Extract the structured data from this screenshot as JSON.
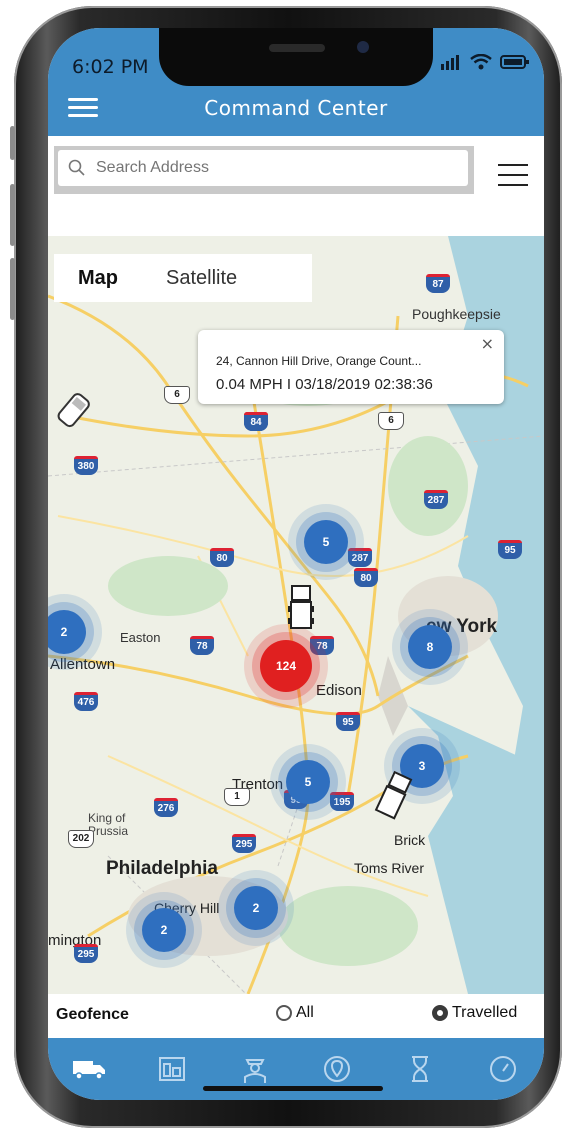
{
  "status_bar": {
    "time": "6:02 PM"
  },
  "header": {
    "title": "Command Center"
  },
  "search": {
    "placeholder": "Search Address"
  },
  "map": {
    "tabs": [
      "Map",
      "Satellite"
    ],
    "active_tab": "Map",
    "popup": {
      "address": "24, Cannon Hill Drive, Orange Count...",
      "info": "0.04 MPH  I  03/18/2019 02:38:36",
      "close": "×"
    },
    "places": [
      "Poughkeepsie",
      "Easton",
      "Allentown",
      "Edison",
      "Trenton",
      "King of Prussia",
      "Philadelphia",
      "Cherry Hill",
      "Brick",
      "Toms River",
      "ew York",
      "mington"
    ],
    "highway_shields": [
      "87",
      "84",
      "6",
      "84",
      "6",
      "380",
      "287",
      "95",
      "80",
      "287",
      "80",
      "78",
      "78",
      "476",
      "95",
      "1",
      "95",
      "195",
      "276",
      "202",
      "295",
      "295"
    ],
    "clusters": [
      {
        "label": "5",
        "color": "#2f6fbf"
      },
      {
        "label": "124",
        "color": "#e02020"
      },
      {
        "label": "8",
        "color": "#2f6fbf"
      },
      {
        "label": "3",
        "color": "#2f6fbf"
      },
      {
        "label": "5",
        "color": "#2f6fbf"
      },
      {
        "label": "2",
        "color": "#2f6fbf"
      },
      {
        "label": "2",
        "color": "#2f6fbf"
      },
      {
        "label": "2",
        "color": "#2f6fbf"
      }
    ]
  },
  "geofence": {
    "label": "Geofence",
    "options": [
      {
        "label": "All",
        "checked": false
      },
      {
        "label": "Travelled",
        "checked": true
      }
    ]
  },
  "bottom_nav": {
    "items": [
      "truck-icon",
      "dashboard-icon",
      "driver-icon",
      "location-pin-icon",
      "hourglass-icon",
      "speedometer-icon"
    ]
  },
  "colors": {
    "accent": "#3f8cc6",
    "cluster_blue": "#2f6fbf",
    "cluster_red": "#e02020"
  }
}
